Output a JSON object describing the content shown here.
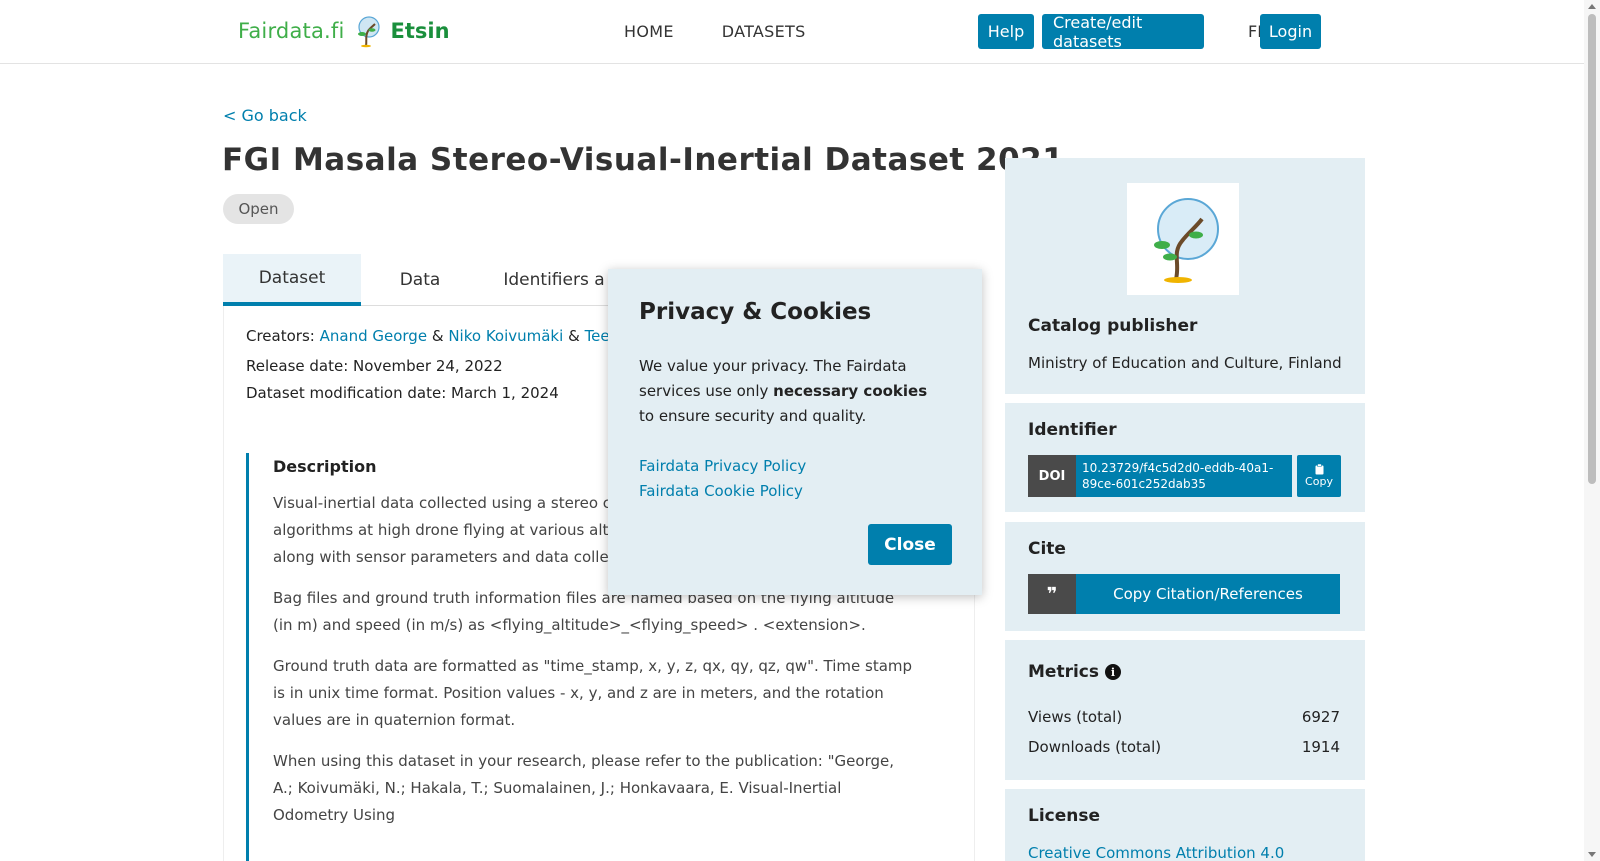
{
  "header": {
    "logo_text": "Fairdata.fi",
    "logo_app": "Etsin",
    "nav": [
      "HOME",
      "DATASETS"
    ],
    "help_label": "Help",
    "create_label": "Create/edit datasets",
    "lang_label": "FI",
    "login_label": "Login"
  },
  "page": {
    "go_back": "< Go back",
    "title": "FGI Masala Stereo-Visual-Inertial Dataset 2021",
    "access_badge": "Open",
    "tabs": [
      "Dataset",
      "Data",
      "Identifiers a"
    ]
  },
  "meta": {
    "creators_label": "Creators:",
    "creators": [
      "Anand George",
      "Niko Koivumäki",
      "Teemu"
    ],
    "separator": "&",
    "release_date": "Release date: November 24, 2022",
    "modification_date": "Dataset modification date: March 1, 2024"
  },
  "description": {
    "heading": "Description",
    "paragraphs": [
      "Visual-inertial data collected using a stereo came performance of VIO/VISLAM algorithms at high drone flying at various altitudes and speeds. The and IMU data, along with sensor parameters and data collection.",
      "Bag files and ground truth information files are named based on the flying altitude (in m) and speed (in m/s) as <flying_altitude>_<flying_speed> . <extension>.",
      "Ground truth data are formatted as \"time_stamp, x, y, z, qx, qy, qz, qw\". Time stamp is in unix time format. Position values - x, y, and z are in meters, and the rotation values are in quaternion format.",
      "When using this dataset in your research, please refer to the publication: \"George, A.; Koivumäki, N.; Hakala, T.; Suomalainen, J.; Honkavaara, E. Visual-Inertial Odometry Using"
    ]
  },
  "sidebar": {
    "catalog_heading": "Catalog publisher",
    "catalog_publisher": "Ministry of Education and Culture, Finland",
    "identifier_heading": "Identifier",
    "doi_label": "DOI",
    "doi_value": "10.23729/f4c5d2d0-eddb-40a1-89ce-601c252dab35",
    "copy_label": "Copy",
    "cite_heading": "Cite",
    "cite_button": "Copy Citation/References",
    "metrics_heading": "Metrics",
    "metrics": [
      {
        "label": "Views (total)",
        "value": "6927"
      },
      {
        "label": "Downloads (total)",
        "value": "1914"
      }
    ],
    "license_heading": "License",
    "license_link": "Creative Commons Attribution 4.0"
  },
  "modal": {
    "title": "Privacy & Cookies",
    "text_before": "We value your privacy. The Fairdata services use only ",
    "text_bold": "necessary cookies",
    "text_after": " to ensure security and quality.",
    "privacy_link": "Fairdata Privacy Policy",
    "cookie_link": "Fairdata Cookie Policy",
    "close_label": "Close"
  },
  "colors": {
    "accent": "#007fad",
    "sidebar_bg": "#e3eef3",
    "logo_green": "#3fae49"
  },
  "icons": [
    "tree-logo-icon",
    "clipboard-icon",
    "quote-icon",
    "info-icon"
  ]
}
